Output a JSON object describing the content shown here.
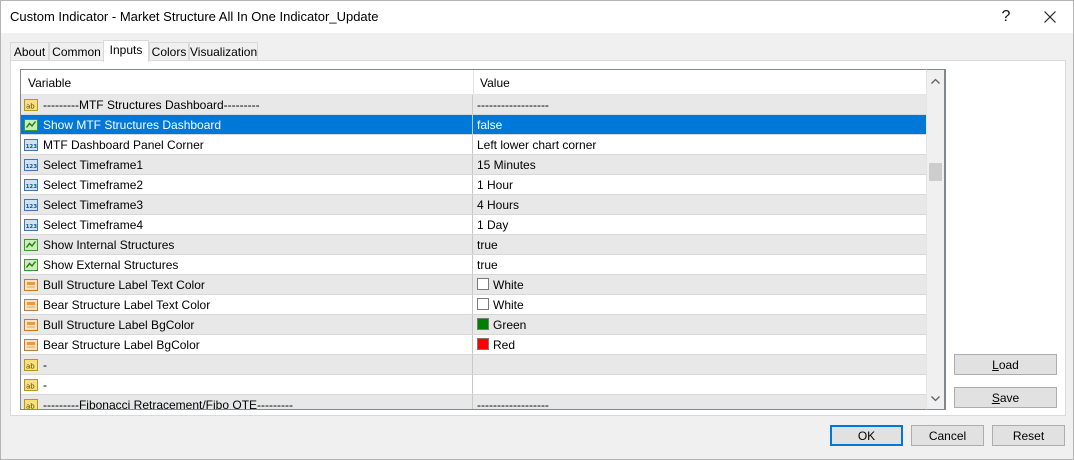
{
  "window": {
    "title": "Custom Indicator - Market Structure All In One Indicator_Update",
    "help_glyph": "?",
    "close_icon": "close-icon"
  },
  "tabs": [
    {
      "label": "About",
      "active": false
    },
    {
      "label": "Common",
      "active": false
    },
    {
      "label": "Inputs",
      "active": true
    },
    {
      "label": "Colors",
      "active": false
    },
    {
      "label": "Visualization",
      "active": false
    }
  ],
  "grid": {
    "columns": {
      "variable": "Variable",
      "value": "Value"
    },
    "rows": [
      {
        "type": "string",
        "variable": "---------MTF Structures Dashboard---------",
        "value": "------------------",
        "selected": false,
        "alt": true
      },
      {
        "type": "bool",
        "variable": "Show MTF Structures Dashboard",
        "value": "false",
        "selected": true,
        "alt": false
      },
      {
        "type": "enum",
        "variable": "MTF Dashboard Panel Corner",
        "value": "Left lower chart corner",
        "selected": false,
        "alt": false
      },
      {
        "type": "enum",
        "variable": "Select Timeframe1",
        "value": "15 Minutes",
        "selected": false,
        "alt": true
      },
      {
        "type": "enum",
        "variable": "Select Timeframe2",
        "value": "1 Hour",
        "selected": false,
        "alt": false
      },
      {
        "type": "enum",
        "variable": "Select Timeframe3",
        "value": "4 Hours",
        "selected": false,
        "alt": true
      },
      {
        "type": "enum",
        "variable": "Select Timeframe4",
        "value": "1 Day",
        "selected": false,
        "alt": false
      },
      {
        "type": "bool",
        "variable": "Show Internal Structures",
        "value": "true",
        "selected": false,
        "alt": true
      },
      {
        "type": "bool",
        "variable": "Show External Structures",
        "value": "true",
        "selected": false,
        "alt": false
      },
      {
        "type": "color",
        "variable": "Bull Structure Label Text Color",
        "value": "White",
        "swatch": "#ffffff",
        "selected": false,
        "alt": true
      },
      {
        "type": "color",
        "variable": "Bear Structure Label Text Color",
        "value": "White",
        "swatch": "#ffffff",
        "selected": false,
        "alt": false
      },
      {
        "type": "color",
        "variable": "Bull Structure Label BgColor",
        "value": "Green",
        "swatch": "#008000",
        "selected": false,
        "alt": true
      },
      {
        "type": "color",
        "variable": "Bear Structure Label BgColor",
        "value": "Red",
        "swatch": "#ff0000",
        "selected": false,
        "alt": false
      },
      {
        "type": "string",
        "variable": "-",
        "value": "",
        "selected": false,
        "alt": true
      },
      {
        "type": "string",
        "variable": "-",
        "value": "",
        "selected": false,
        "alt": false
      },
      {
        "type": "string",
        "variable": "---------Fibonacci Retracement/Fibo OTE---------",
        "value": "------------------",
        "selected": false,
        "alt": true
      }
    ]
  },
  "buttons": {
    "load_prefix": "",
    "load_mnemonic": "L",
    "load_rest": "oad",
    "save_mnemonic": "S",
    "save_rest": "ave",
    "ok": "OK",
    "cancel": "Cancel",
    "reset": "Reset"
  },
  "colors": {
    "selection": "#0078d7",
    "alt_row": "#e8e8e8",
    "ok_border": "#0078d7"
  }
}
